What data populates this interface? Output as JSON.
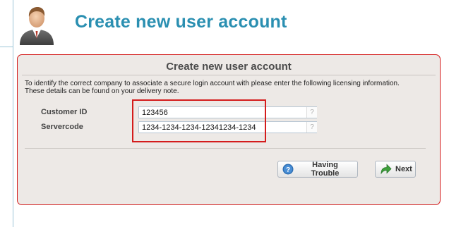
{
  "header": {
    "title": "Create new user account",
    "icon": "user-avatar-icon"
  },
  "panel": {
    "title": "Create new user account",
    "intro": "To identify the correct company to associate a secure login account with please enter the following licensing information. These details can be found on your delivery note.",
    "fields": [
      {
        "label": "Customer ID",
        "value": "123456",
        "help": "?"
      },
      {
        "label": "Servercode",
        "value": "1234-1234-1234-12341234-1234",
        "help": "?"
      }
    ],
    "buttons": {
      "trouble_label": "Having Trouble",
      "next_label": "Next"
    }
  },
  "colors": {
    "title": "#2a8fb1",
    "panel_border": "#d41c1c",
    "panel_bg": "#ede9e6",
    "highlight": "#d41c1c"
  }
}
